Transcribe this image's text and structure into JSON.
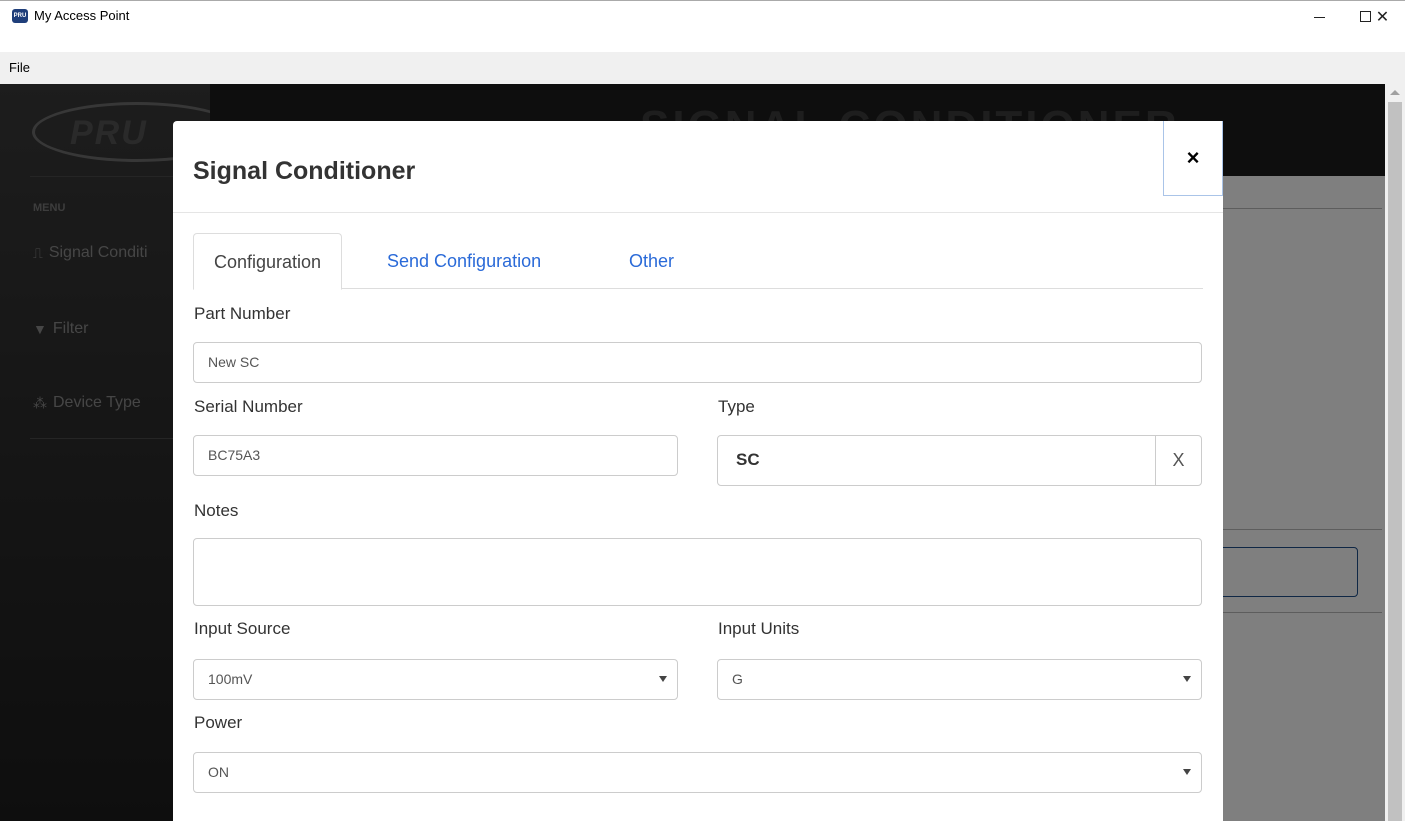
{
  "window": {
    "title": "My Access Point",
    "app_icon_text": "PRU",
    "minimize_label": "",
    "maximize_label": "",
    "close_label": "✕"
  },
  "menu": {
    "file_label": "File"
  },
  "sidebar": {
    "brand": "PRU",
    "menu_label": "MENU",
    "items": [
      {
        "label": "Signal Conditi",
        "icon": "signal-wave-icon"
      },
      {
        "label": "Filter",
        "icon": "funnel-icon"
      },
      {
        "label": "Device Type",
        "icon": "cubes-icon"
      }
    ]
  },
  "header": {
    "title": "SIGNAL CONDITIONER"
  },
  "modal": {
    "title": "Signal Conditioner",
    "close_label": "×",
    "tabs": [
      {
        "label": "Configuration",
        "active": true
      },
      {
        "label": "Send Configuration",
        "active": false
      },
      {
        "label": "Other",
        "active": false
      }
    ],
    "part_number": {
      "label": "Part Number",
      "value": "New SC"
    },
    "serial_number": {
      "label": "Serial Number",
      "value": "BC75A3"
    },
    "type": {
      "label": "Type",
      "value": "SC",
      "clear_label": "X"
    },
    "notes": {
      "label": "Notes",
      "value": ""
    },
    "input_source": {
      "label": "Input Source",
      "value": "100mV"
    },
    "input_units": {
      "label": "Input Units",
      "value": "G"
    },
    "power": {
      "label": "Power",
      "value": "ON"
    }
  },
  "colors": {
    "accent": "#2a6ad8",
    "sidebar_bg": "#2b2b2b",
    "header_bg": "#1c1c1c"
  }
}
